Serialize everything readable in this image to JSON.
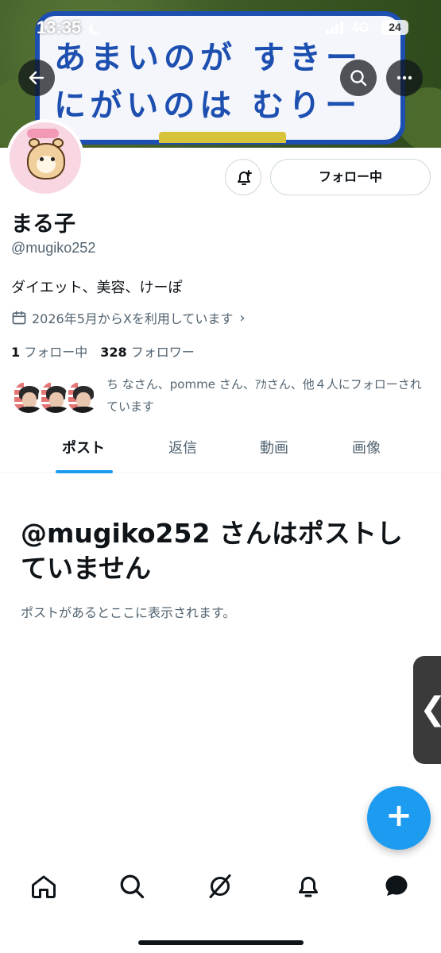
{
  "status_bar": {
    "time": "13:35",
    "network": "4G",
    "battery": "24"
  },
  "banner": {
    "line1": "あまいのが すきー",
    "line2": "にがいのは むりー"
  },
  "profile": {
    "display_name": "まる子",
    "handle": "@mugiko252",
    "bio": "ダイエット、美容、けーぽ",
    "joined": "2026年5月からXを利用しています",
    "following_count": "1",
    "following_label": "フォロー中",
    "followers_count": "328",
    "followers_label": "フォロワー",
    "followed_by": "ち なさん、pomme さん、ｱｶさん、他４人にフォローされています"
  },
  "actions": {
    "follow_label": "フォロー中"
  },
  "tabs": [
    {
      "label": "ポスト"
    },
    {
      "label": "返信"
    },
    {
      "label": "動画"
    },
    {
      "label": "画像"
    }
  ],
  "empty_state": {
    "title": "@mugiko252 さんはポストしていません",
    "subtitle": "ポストがあるとここに表示されます。"
  },
  "fab": {
    "label": "+"
  },
  "edge_handle": {
    "label": "❮"
  },
  "icons": {
    "back": "back-arrow-icon",
    "search": "search-icon",
    "more": "more-icon",
    "notify": "notification-bell-icon",
    "calendar": "calendar-icon",
    "home": "home-icon",
    "explore": "search-icon",
    "grok": "grok-icon",
    "notifications": "bell-icon",
    "messages": "message-icon"
  },
  "colors": {
    "accent": "#1d9bf0",
    "text_primary": "#0f1419",
    "text_secondary": "#536471",
    "border": "#cfd9de"
  }
}
